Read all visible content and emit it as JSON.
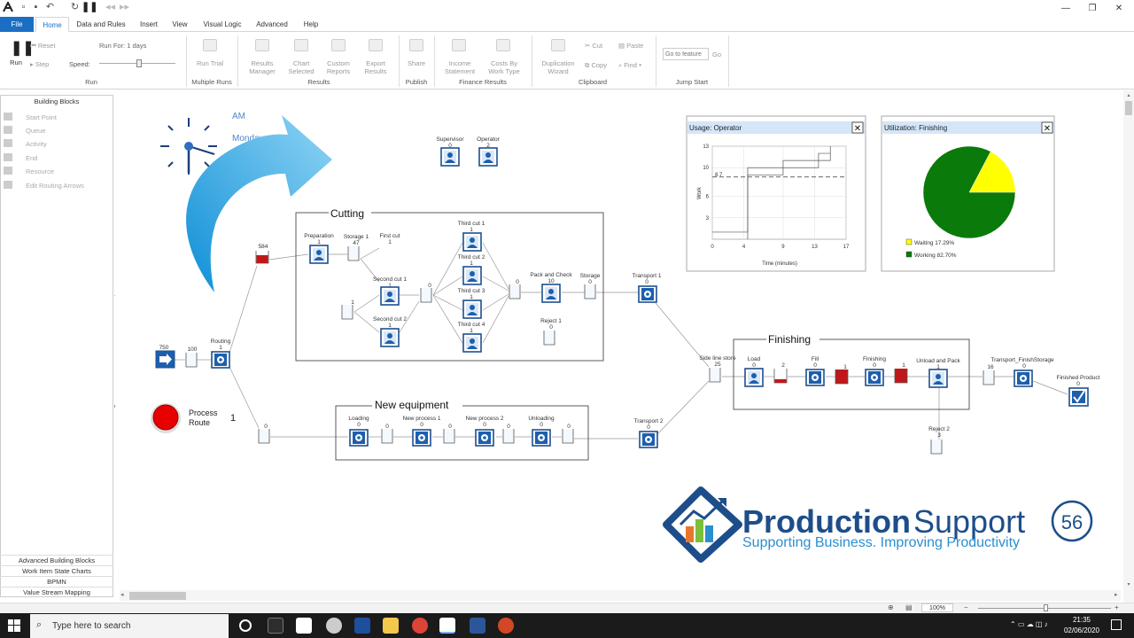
{
  "titlebar": {
    "window_controls": [
      "minimize-icon",
      "maximize-icon",
      "close-icon"
    ]
  },
  "tabs": [
    "File",
    "Home",
    "Data and Rules",
    "Insert",
    "View",
    "Visual Logic",
    "Advanced",
    "Help"
  ],
  "ribbon": {
    "run": {
      "run_label": "Run",
      "reset": "Reset",
      "step": "Step",
      "run_for": "Run For: 1 days",
      "speed": "Speed:",
      "group": "Run"
    },
    "multiple_runs": {
      "run_trial": "Run Trial",
      "group": "Multiple Runs"
    },
    "results": {
      "manager": "Results Manager",
      "chart_selected": "Chart Selected",
      "custom_reports": "Custom Reports",
      "export_results": "Export Results",
      "group": "Results"
    },
    "publish": {
      "share": "Share",
      "group": "Publish"
    },
    "finance": {
      "income": "Income Statement",
      "costs": "Costs By Work Type",
      "group": "Finance Results"
    },
    "clipboard": {
      "duplication": "Duplication Wizard",
      "cut": "Cut",
      "copy": "Copy",
      "paste": "Paste",
      "find": "Find",
      "group": "Clipboard"
    },
    "jump": {
      "placeholder": "Go to feature",
      "go": "Go",
      "group": "Jump Start"
    }
  },
  "left_panel": {
    "title": "Building Blocks",
    "items": [
      "Start Point",
      "Queue",
      "Activity",
      "End",
      "Resource",
      "Edit Routing Arrows"
    ],
    "bottom": [
      "Advanced Building Blocks",
      "Work Item State Charts",
      "BPMN",
      "Value Stream Mapping"
    ]
  },
  "clock": {
    "period": "AM",
    "day": "Monday"
  },
  "process_route": {
    "label_line1": "Process",
    "label_line2": "Route",
    "count": "1"
  },
  "resources": [
    {
      "name": "Supervisor",
      "count": "0"
    },
    {
      "name": "Operator",
      "count": "2"
    }
  ],
  "model": {
    "start_count": "750",
    "queue_100": "100",
    "routing": "Routing",
    "routing_count": "1",
    "store_584": "584",
    "store_0": "0",
    "cutting": {
      "title": "Cutting",
      "preparation": "Preparation",
      "preparation_count": "1",
      "storage1": "Storage 1",
      "storage1_count": "47",
      "first_cut": "First cut",
      "first_cut_count": "1",
      "second_cut1": "Second cut 1",
      "second_cut1_count": "1",
      "second_cut2": "Second cut 2",
      "second_cut2_count": "1",
      "q1": "1",
      "q0a": "0",
      "third_cut1": "Third cut 1",
      "third_cut1_count": "1",
      "third_cut2": "Third cut 2",
      "third_cut2_count": "1",
      "third_cut3": "Third cut 3",
      "third_cut3_count": "1",
      "third_cut4": "Third cut 4",
      "third_cut4_count": "1",
      "q0b": "0",
      "pack_check": "Pack and Check",
      "pack_check_count": "10",
      "storage": "Storage",
      "storage_count": "0",
      "reject1": "Reject 1",
      "reject1_count": "0"
    },
    "new_equipment": {
      "title": "New equipment",
      "loading": "Loading",
      "loading_count": "0",
      "np1": "New process 1",
      "np1_count": "0",
      "np2": "New process 2",
      "np2_count": "0",
      "unloading": "Unloading",
      "unloading_count": "0",
      "q0": "0"
    },
    "transport1": "Transport 1",
    "transport1_count": "0",
    "transport2": "Transport 2",
    "transport2_count": "0",
    "side_line": "Side line store",
    "side_line_count": "25",
    "finishing": {
      "title": "Finishing",
      "load": "Load",
      "load_count": "0",
      "q2": "2",
      "fill": "Fill",
      "fill_count": "0",
      "q1a": "1",
      "fin": "Finishing",
      "fin_count": "0",
      "q1b": "1",
      "unload_pack": "Unload and Pack",
      "unload_pack_count": "1"
    },
    "tf_queue": "16",
    "transport_finish": "Transport_FinishStorage",
    "transport_finish_count": "0",
    "reject2": "Reject 2",
    "reject2_count": "3",
    "finished": "Finished Product",
    "finished_count": "0"
  },
  "usage_chart": {
    "title": "Usage: Operator",
    "chart_data": {
      "type": "line",
      "title": "",
      "xlabel": "Time (minutes)",
      "ylabel": "Work",
      "x_ticks": [
        0,
        4,
        9,
        13,
        17
      ],
      "y_ticks": [
        3,
        6,
        10,
        13
      ],
      "average": 8.7,
      "average_label": "8.7",
      "xlim": [
        0,
        17
      ],
      "ylim": [
        0,
        13
      ],
      "series": [
        {
          "values_x": [
            0,
            4.5,
            4.5,
            9,
            9,
            13.5,
            13.5,
            15
          ],
          "values_y": [
            1,
            1,
            10,
            10,
            11,
            11,
            12,
            12
          ]
        },
        {
          "values_x": [
            4.5,
            4.5,
            9,
            9,
            13.5,
            13.5,
            15,
            15
          ],
          "values_y": [
            0,
            9,
            9,
            10,
            10,
            11,
            11,
            13
          ]
        }
      ]
    }
  },
  "utilization_chart": {
    "title": "Utilization: Finishing",
    "chart_data": {
      "type": "pie",
      "slices": [
        {
          "label": "Waiting 17.29%",
          "value": 17.29,
          "color": "#ffff00"
        },
        {
          "label": "Working 82.70%",
          "value": 82.7,
          "color": "#0a7a0a"
        }
      ]
    }
  },
  "logo": {
    "name_bold": "Production",
    "name_light": "Support",
    "badge": "56",
    "tagline": "Supporting Business. Improving Productivity"
  },
  "status": {
    "zoom": "100%"
  },
  "taskbar": {
    "search_placeholder": "Type here to search",
    "time": "21:35",
    "date": "02/06/2020"
  }
}
